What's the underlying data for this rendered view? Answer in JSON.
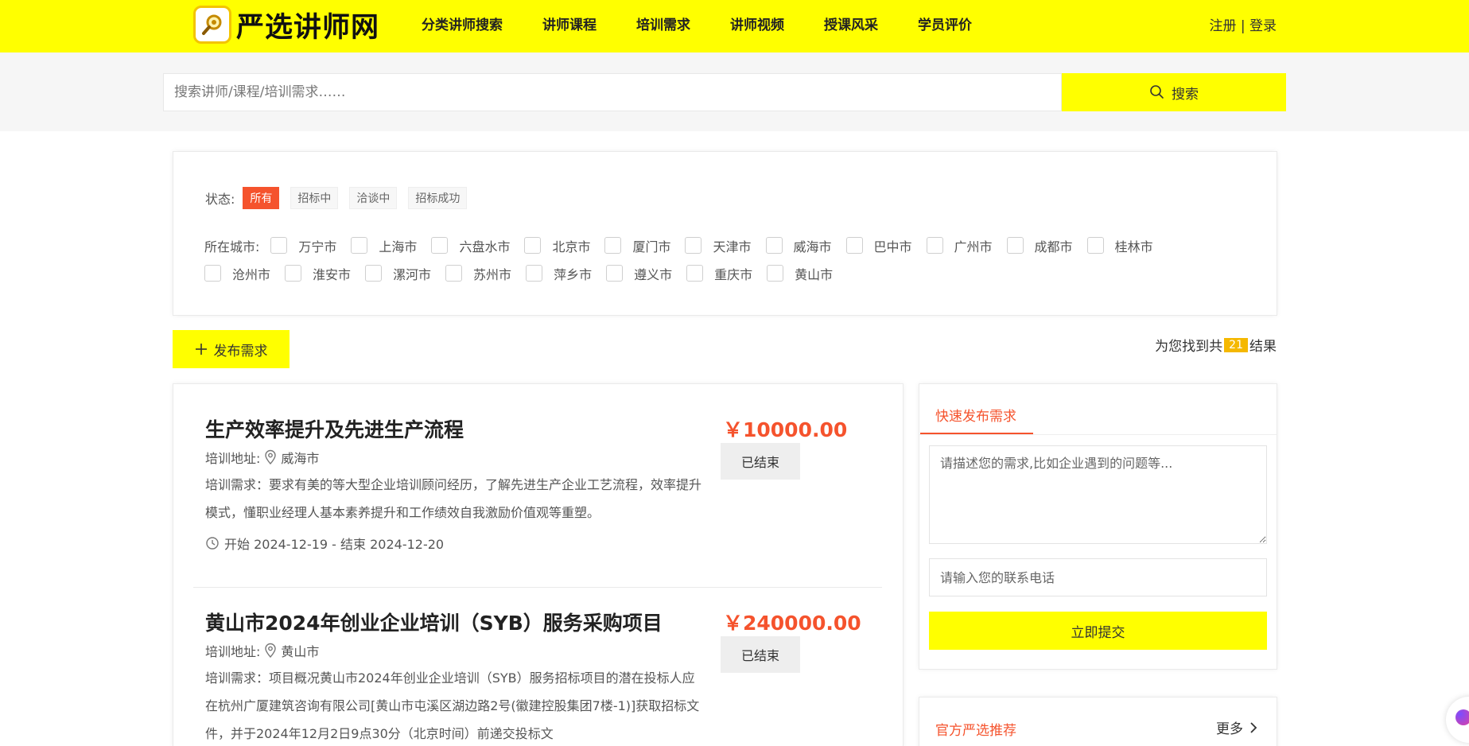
{
  "header": {
    "logo_text": "严选讲师网",
    "nav": [
      "分类讲师搜索",
      "讲师课程",
      "培训需求",
      "讲师视频",
      "授课风采",
      "学员评价"
    ],
    "auth_text": "注册 | 登录"
  },
  "search": {
    "placeholder": "搜索讲师/课程/培训需求……",
    "button_label": "搜索"
  },
  "filters": {
    "status_label": "状态:",
    "status_options": [
      "所有",
      "招标中",
      "洽谈中",
      "招标成功"
    ],
    "active_status": "所有",
    "city_label": "所在城市:",
    "cities_row1": [
      "万宁市",
      "上海市",
      "六盘水市",
      "北京市",
      "厦门市",
      "天津市",
      "威海市",
      "巴中市",
      "广州市",
      "成都市",
      "桂林市"
    ],
    "cities_row2": [
      "沧州市",
      "淮安市",
      "漯河市",
      "苏州市",
      "萍乡市",
      "遵义市",
      "重庆市",
      "黄山市"
    ]
  },
  "toolbar": {
    "publish_label": "发布需求",
    "result_prefix": "为您找到共",
    "result_count": "21",
    "result_suffix": "结果"
  },
  "list": {
    "items": [
      {
        "title": "生产效率提升及先进生产流程",
        "price": "￥10000.00",
        "status": "已结束",
        "addr_label": "培训地址:",
        "addr": "威海市",
        "desc": "培训需求：要求有美的等大型企业培训顾问经历，了解先进生产企业工艺流程，效率提升模式，懂职业经理人基本素养提升和工作绩效自我激励价值观等重塑。",
        "date": "开始 2024-12-19 - 结束 2024-12-20"
      },
      {
        "title": "黄山市2024年创业企业培训（SYB）服务采购项目",
        "price": "￥240000.00",
        "status": "已结束",
        "addr_label": "培训地址:",
        "addr": "黄山市",
        "desc": "培训需求：项目概况黄山市2024年创业企业培训（SYB）服务招标项目的潜在投标人应在杭州广厦建筑咨询有限公司[黄山市屯溪区湖边路2号(徽建控股集团7楼-1)]获取招标文件，并于2024年12月2日9点30分（北京时间）前递交投标文"
      }
    ]
  },
  "side_form": {
    "tab_label": "快速发布需求",
    "textarea_placeholder": "请描述您的需求,比如企业遇到的问题等...",
    "phone_placeholder": "请输入您的联系电话",
    "submit_label": "立即提交"
  },
  "recommend": {
    "title": "官方严选推荐",
    "more_label": "更多"
  },
  "colors": {
    "brand_yellow": "#ffff00",
    "accent_orange": "#f5532d",
    "badge_gold": "#f5b800"
  }
}
